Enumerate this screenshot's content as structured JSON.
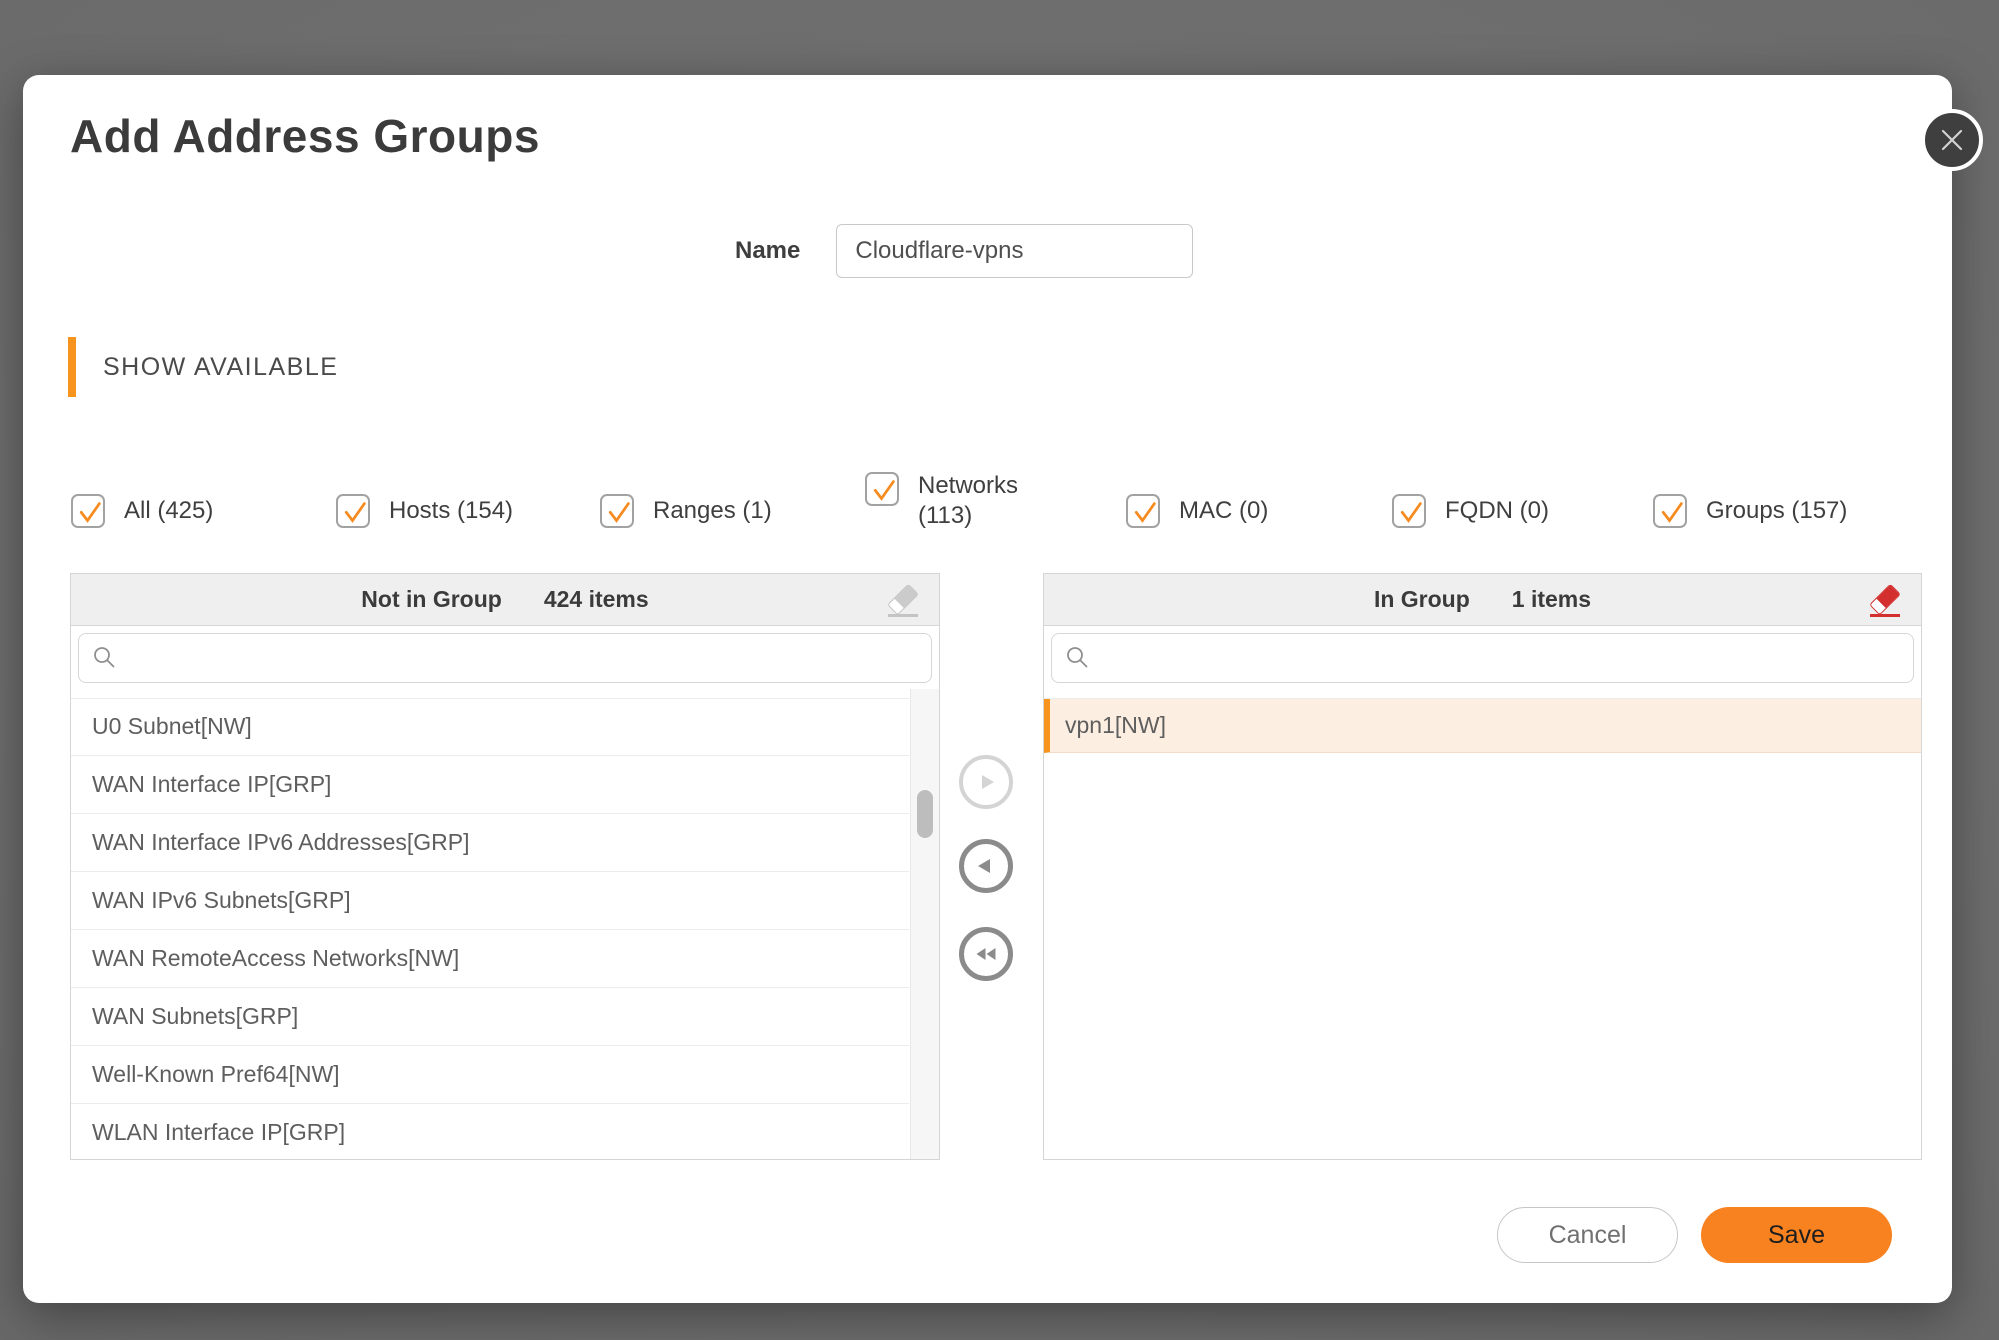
{
  "dialog": {
    "title": "Add Address Groups",
    "name_label": "Name",
    "name_value": "Cloudflare-vpns",
    "section_header": "SHOW AVAILABLE"
  },
  "filters": [
    {
      "label": "All (425)",
      "checked": true
    },
    {
      "label": "Hosts (154)",
      "checked": true
    },
    {
      "label": "Ranges (1)",
      "checked": true
    },
    {
      "label": "Networks (113)",
      "checked": true
    },
    {
      "label": "MAC (0)",
      "checked": true
    },
    {
      "label": "FQDN (0)",
      "checked": true
    },
    {
      "label": "Groups (157)",
      "checked": true
    }
  ],
  "left_panel": {
    "title": "Not in Group",
    "count": "424 items",
    "search_value": "",
    "items": [
      "U0 Subnet[NW]",
      "WAN Interface IP[GRP]",
      "WAN Interface IPv6 Addresses[GRP]",
      "WAN IPv6 Subnets[GRP]",
      "WAN RemoteAccess Networks[NW]",
      "WAN Subnets[GRP]",
      "Well-Known Pref64[NW]",
      "WLAN Interface IP[GRP]"
    ]
  },
  "right_panel": {
    "title": "In Group",
    "count": "1 items",
    "search_value": "",
    "items": [
      "vpn1[NW]"
    ],
    "selected_item": "vpn1[NW]"
  },
  "footer": {
    "cancel_label": "Cancel",
    "save_label": "Save"
  },
  "colors": {
    "accent_orange": "#f7941e",
    "save_button_orange": "#f8821f",
    "selected_row_bg": "#fdeee2",
    "eraser_red": "#d32f2f",
    "overlay_background": "#6a6a6a"
  },
  "icons": {
    "close": "close-icon",
    "search": "search-icon",
    "eraser_clear": "eraser-icon",
    "move_right": "arrow-right-icon",
    "move_left": "arrow-left-icon",
    "move_all_left": "double-arrow-left-icon",
    "checkbox_check": "check-icon"
  }
}
